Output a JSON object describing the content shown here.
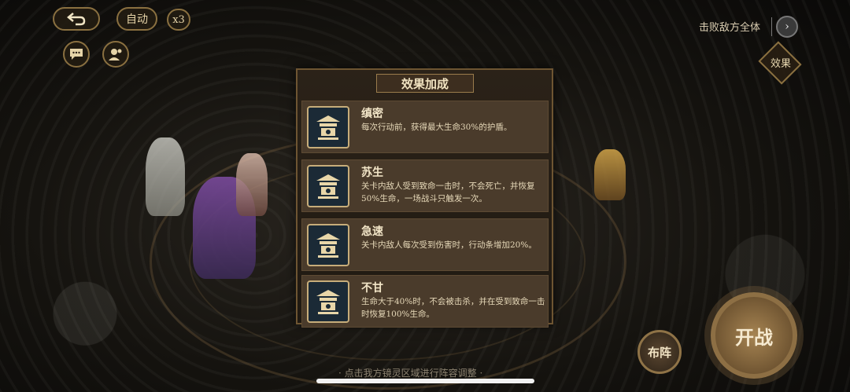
{
  "controls": {
    "auto_label": "自动",
    "speed_label": "x3"
  },
  "top_right": {
    "defeat_label": "击败敌方全体",
    "effect_label": "效果"
  },
  "panel": {
    "title": "效果加成",
    "effects": [
      {
        "name": "缜密",
        "desc": "每次行动前，获得最大生命30%的护盾。"
      },
      {
        "name": "苏生",
        "desc": "关卡内敌人受到致命一击时，不会死亡，并恢复50%生命，一场战斗只触发一次。"
      },
      {
        "name": "急速",
        "desc": "关卡内敌人每次受到伤害时，行动条增加20%。"
      },
      {
        "name": "不甘",
        "desc": "生命大于40%时，不会被击杀，并在受到致命一击时恢复100%生命。"
      }
    ]
  },
  "bottom": {
    "hint": "· 点击我方镜灵区域进行阵容调整 ·",
    "formation_label": "布阵",
    "battle_label": "开战"
  }
}
